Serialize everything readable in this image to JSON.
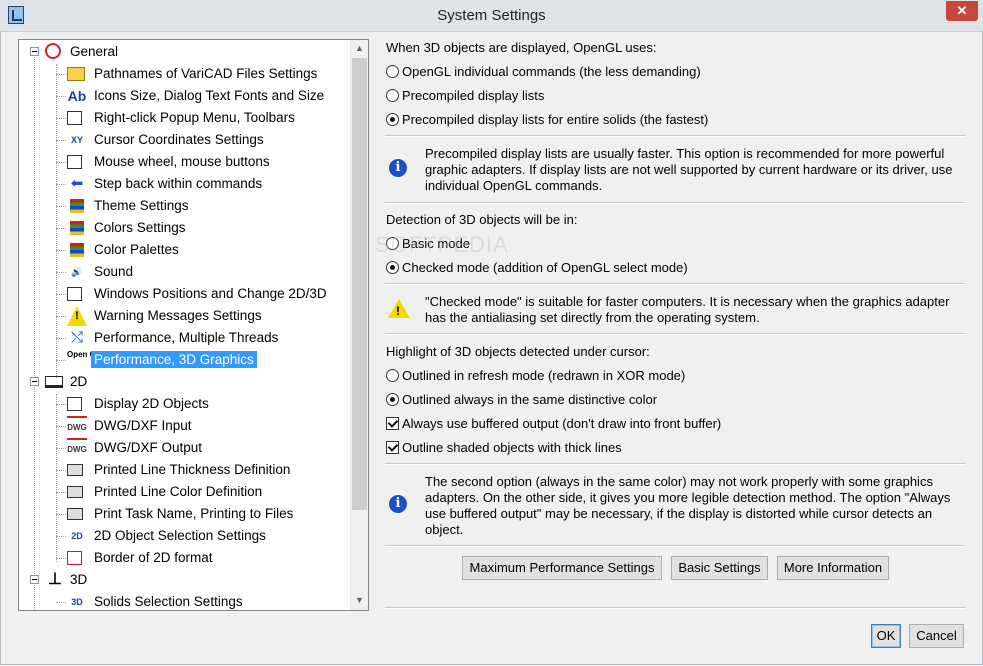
{
  "window": {
    "title": "System Settings",
    "close": "✕"
  },
  "tree": {
    "groups": [
      {
        "label": "General",
        "icon": "general-circle-icon"
      },
      {
        "label": "2D",
        "icon": "2d-icon"
      },
      {
        "label": "3D",
        "icon": "3d-axes-icon"
      }
    ],
    "items": [
      {
        "label": "Pathnames of VariCAD Files Settings",
        "icon": "folder-icon",
        "glyph": ""
      },
      {
        "label": "Icons Size, Dialog Text Fonts and Size",
        "icon": "font-ab-icon",
        "glyph": "Ab"
      },
      {
        "label": "Right-click Popup Menu, Toolbars",
        "icon": "popup-menu-icon",
        "glyph": ""
      },
      {
        "label": "Cursor Coordinates Settings",
        "icon": "cursor-xy-icon",
        "glyph": "XY"
      },
      {
        "label": "Mouse wheel, mouse buttons",
        "icon": "mouse-icon",
        "glyph": ""
      },
      {
        "label": "Step back within commands",
        "icon": "arrow-left-icon",
        "glyph": "⬅"
      },
      {
        "label": "Theme Settings",
        "icon": "theme-icon",
        "glyph": ""
      },
      {
        "label": "Colors Settings",
        "icon": "colors-icon",
        "glyph": ""
      },
      {
        "label": "Color Palettes",
        "icon": "color-palette-icon",
        "glyph": ""
      },
      {
        "label": "Sound",
        "icon": "speaker-icon",
        "glyph": "🔊"
      },
      {
        "label": "Windows Positions and Change 2D/3D",
        "icon": "windows-icon",
        "glyph": ""
      },
      {
        "label": "Warning Messages Settings",
        "icon": "warning-icon",
        "glyph": "!"
      },
      {
        "label": "Performance, Multiple Threads",
        "icon": "shuffle-icon",
        "glyph": "⤭"
      },
      {
        "label": "Performance, 3D Graphics",
        "icon": "opengl-icon",
        "glyph": "Open GL"
      },
      {
        "label": "Display 2D Objects",
        "icon": "display-2d-icon",
        "glyph": ""
      },
      {
        "label": "DWG/DXF Input",
        "icon": "dwg-input-icon",
        "glyph": "DWG"
      },
      {
        "label": "DWG/DXF Output",
        "icon": "dwg-output-icon",
        "glyph": "DWG"
      },
      {
        "label": "Printed Line Thickness Definition",
        "icon": "printer-icon",
        "glyph": ""
      },
      {
        "label": "Printed Line Color Definition",
        "icon": "printer-icon",
        "glyph": ""
      },
      {
        "label": "Print Task Name, Printing to Files",
        "icon": "printer-icon",
        "glyph": ""
      },
      {
        "label": "2D Object Selection Settings",
        "icon": "select-2d-icon",
        "glyph": "2D"
      },
      {
        "label": "Border of 2D format",
        "icon": "border-icon",
        "glyph": ""
      },
      {
        "label": "Solids Selection Settings",
        "icon": "select-3d-icon",
        "glyph": "3D"
      }
    ],
    "selected_index": 13
  },
  "opengl": {
    "heading": "When 3D objects are displayed, OpenGL uses:",
    "options": [
      {
        "label": "OpenGL individual commands (the less demanding)",
        "selected": false
      },
      {
        "label": "Precompiled display lists",
        "selected": false
      },
      {
        "label": "Precompiled display lists for entire solids (the fastest)",
        "selected": true
      }
    ],
    "info_symbol": "i",
    "info": "Precompiled display lists are usually faster. This option is recommended for more powerful graphic adapters. If display lists are not well supported by current hardware or its driver, use individual OpenGL commands."
  },
  "detection": {
    "heading": "Detection of 3D objects will be in:",
    "options": [
      {
        "label": "Basic mode",
        "selected": false
      },
      {
        "label": "Checked mode (addition of OpenGL select mode)",
        "selected": true
      }
    ],
    "warning_symbol": "!",
    "warning": "\"Checked mode\" is suitable for faster computers. It is necessary when the graphics adapter has the antialiasing set directly from the operating system."
  },
  "highlight": {
    "heading": "Highlight of 3D objects detected under cursor:",
    "options": [
      {
        "label": "Outlined in refresh mode (redrawn in XOR mode)",
        "selected": false
      },
      {
        "label": "Outlined always in the same distinctive color",
        "selected": true
      }
    ],
    "checks": [
      {
        "label": "Always use buffered output (don't draw into front buffer)",
        "checked": true
      },
      {
        "label": "Outline shaded objects with thick lines",
        "checked": true
      }
    ],
    "info_symbol": "i",
    "info": "The second option (always in the same color) may not work properly with some graphics adapters. On the other side, it gives you more legible detection method. The option \"Always use buffered output\" may be necessary, if the display is distorted while cursor detects an object."
  },
  "buttons": {
    "max_perf": "Maximum Performance Settings",
    "basic": "Basic Settings",
    "more_info": "More Information",
    "ok": "OK",
    "cancel": "Cancel"
  },
  "watermark": "SOFTPEDIA",
  "colors": {
    "selection": "#3399ff",
    "close": "#c7483b",
    "info": "#1e4fc8",
    "warning": "#f5d800"
  }
}
